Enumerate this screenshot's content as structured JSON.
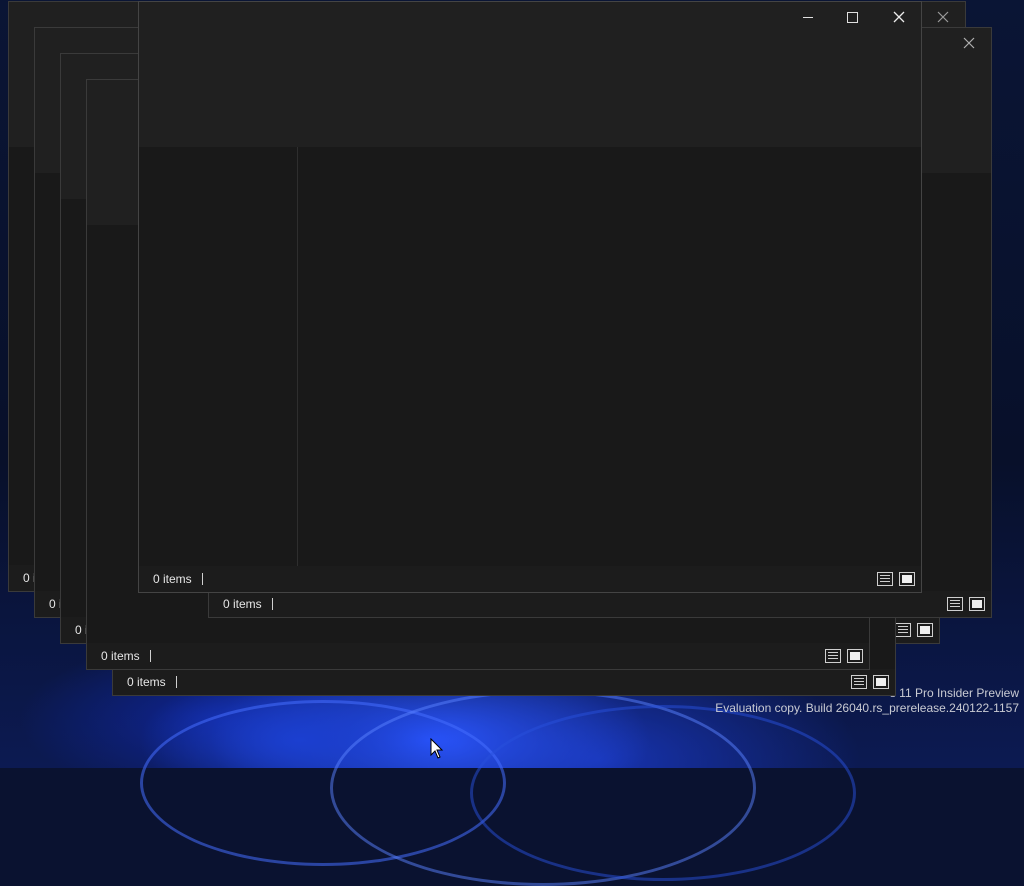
{
  "desktop": {
    "watermark_line1": "s 11 Pro Insider Preview",
    "watermark_line2": "Evaluation copy. Build 26040.rs_prerelease.240122-1157"
  },
  "windows": [
    {
      "status_text": "0 i"
    },
    {
      "status_text": "0 i"
    },
    {
      "status_text": "0 i"
    },
    {
      "status_text": "0 items"
    },
    {
      "status_text": "0 items"
    },
    {
      "status_text": "0 items"
    },
    {
      "status_text": "0 items"
    }
  ],
  "icons": {
    "details_view": "details-view-icon",
    "large_icons_view": "large-icons-view-icon",
    "minimize": "minimize-icon",
    "maximize": "maximize-icon",
    "close": "close-icon",
    "cursor": "mouse-pointer-icon"
  }
}
